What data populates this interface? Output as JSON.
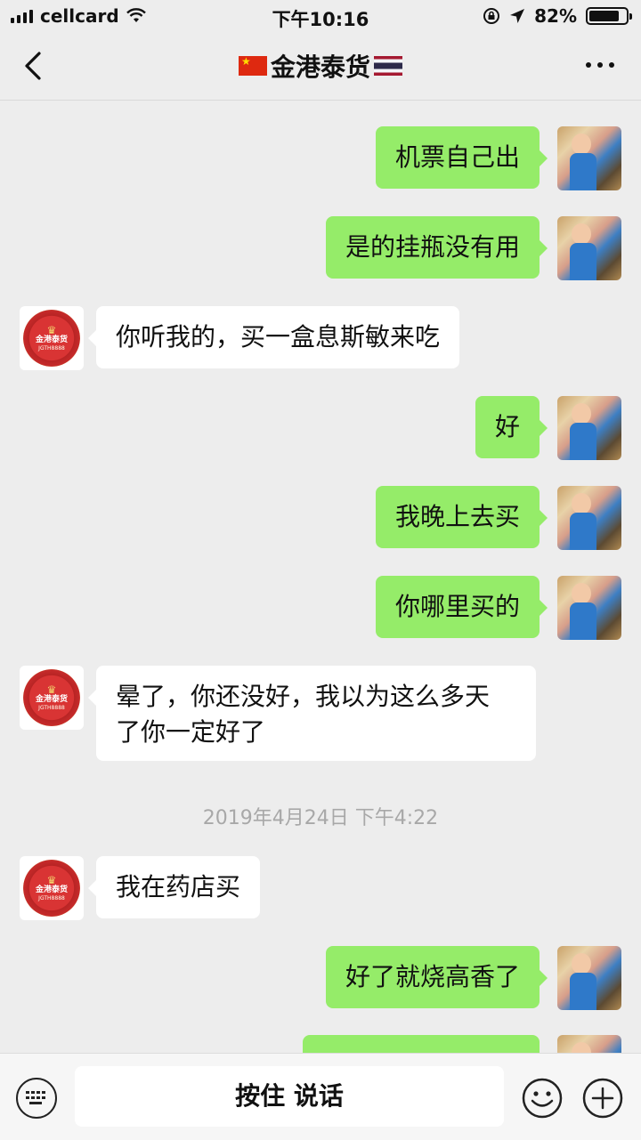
{
  "status_bar": {
    "carrier": "cellcard",
    "time": "下午10:16",
    "battery": "82%",
    "battery_level": 0.82
  },
  "header": {
    "title": "金港泰货",
    "left_flag": "china-flag",
    "right_flag": "thailand-flag"
  },
  "contact_avatar": {
    "line1": "金港泰货",
    "line2": "JGTH8888"
  },
  "messages": [
    {
      "side": "right",
      "text": "机票自己出"
    },
    {
      "side": "right",
      "text": "是的挂瓶没有用"
    },
    {
      "side": "left",
      "text": "你听我的，买一盒息斯敏来吃"
    },
    {
      "side": "right",
      "text": "好"
    },
    {
      "side": "right",
      "text": "我晚上去买"
    },
    {
      "side": "right",
      "text": "你哪里买的"
    },
    {
      "side": "left",
      "line1": "晕了，你还没好，我以为这么多天",
      "line2": "了你一定好了"
    },
    {
      "side": "left",
      "text": "我在药店买"
    },
    {
      "side": "right",
      "text": "好了就烧高香了"
    }
  ],
  "timestamp": "2019年4月24日 下午4:22",
  "input_bar": {
    "hold_to_talk": "按住 说话"
  },
  "colors": {
    "sent_bubble": "#95ec69",
    "received_bubble": "#ffffff",
    "background": "#ededed"
  }
}
